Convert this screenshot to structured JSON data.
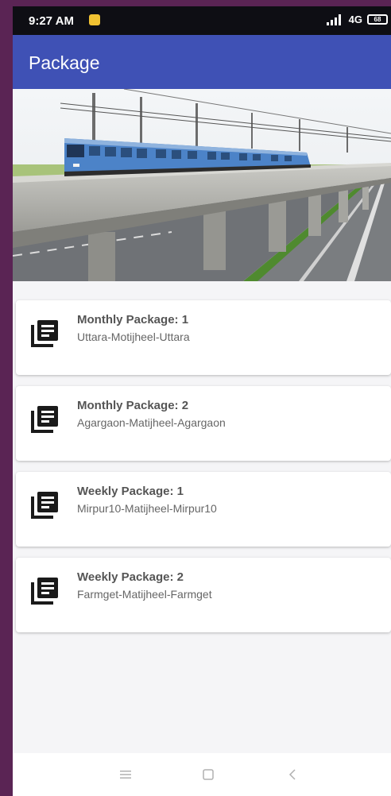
{
  "status_bar": {
    "time": "9:27 AM",
    "network": "4G",
    "battery": "68"
  },
  "app_bar": {
    "title": "Package"
  },
  "packages": [
    {
      "title": "Monthly Package: 1",
      "route": "Uttara-Motijheel-Uttara"
    },
    {
      "title": "Monthly Package: 2",
      "route": "Agargaon-Matijheel-Agargaon"
    },
    {
      "title": "Weekly Package: 1",
      "route": "Mirpur10-Matijheel-Mirpur10"
    },
    {
      "title": "Weekly Package: 2",
      "route": "Farmget-Matijheel-Farmget"
    }
  ],
  "colors": {
    "app_bar": "#3f51b5",
    "status_bar": "#0e0e14",
    "background_frame": "#5a2454",
    "card_icon": "#1a1a1a"
  },
  "icons": {
    "package_icon": "library-books-icon",
    "nav_menu": "menu-icon",
    "nav_home": "square-home-icon",
    "nav_back": "chevron-left-icon"
  }
}
